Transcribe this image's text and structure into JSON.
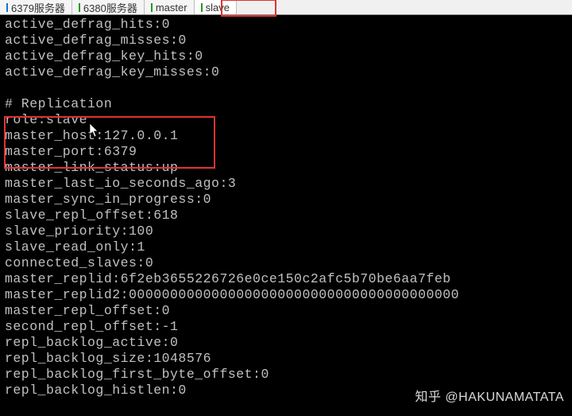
{
  "tabBar": {
    "tabs": [
      {
        "label": "6379服务器",
        "marker": "blue",
        "active": false
      },
      {
        "label": "6380服务器",
        "marker": "green",
        "active": false
      },
      {
        "label": "master",
        "marker": "green",
        "active": false
      },
      {
        "label": "slave",
        "marker": "green",
        "active": true
      }
    ]
  },
  "terminal": {
    "lines": [
      "active_defrag_hits:0",
      "active_defrag_misses:0",
      "active_defrag_key_hits:0",
      "active_defrag_key_misses:0",
      "",
      "# Replication",
      "role:slave",
      "master_host:127.0.0.1",
      "master_port:6379",
      "master_link_status:up",
      "master_last_io_seconds_ago:3",
      "master_sync_in_progress:0",
      "slave_repl_offset:618",
      "slave_priority:100",
      "slave_read_only:1",
      "connected_slaves:0",
      "master_replid:6f2eb3655226726e0ce150c2afc5b70be6aa7feb",
      "master_replid2:0000000000000000000000000000000000000000",
      "master_repl_offset:0",
      "second_repl_offset:-1",
      "repl_backlog_active:0",
      "repl_backlog_size:1048576",
      "repl_backlog_first_byte_offset:0",
      "repl_backlog_histlen:0"
    ]
  },
  "watermark": "知乎 @HAKUNAMATATA"
}
